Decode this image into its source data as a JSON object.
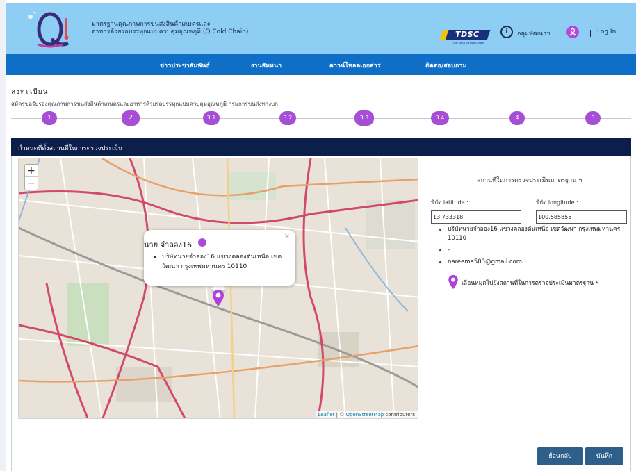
{
  "header": {
    "site_title_line1": "มาตรฐานคุณภาพการขนส่งสินค้าเกษตรและ",
    "site_title_line2": "อาหารด้วยรถบรรทุกแบบควบคุมอุณหภูมิ (Q Cold Chain)",
    "partner_logo_text": "TDSC",
    "partner_logo_sub": "Thai Delta Service Centre",
    "help_label": "กลุ่มพัฒนาฯ",
    "login_label": "Log In"
  },
  "nav": {
    "items": [
      {
        "label": "ข่าวประชาสัมพันธ์"
      },
      {
        "label": "งานสัมมนา"
      },
      {
        "label": "ดาวน์โหลดเอกสาร"
      },
      {
        "label": "ติดต่อ/สอบถาม"
      }
    ]
  },
  "registration": {
    "title": "ลงทะเบียน",
    "subtitle": "สมัครขอรับรองคุณภาพการขนส่งสินค้าเกษตรและอาหารด้วยรถบรรทุกแบบควบคุมอุณหภูมิ กรมการขนส่งทางบก"
  },
  "steps": [
    {
      "label": "1"
    },
    {
      "label": "2"
    },
    {
      "label": "3.1"
    },
    {
      "label": "3.2"
    },
    {
      "label": "3.3"
    },
    {
      "label": "3.4"
    },
    {
      "label": "4"
    },
    {
      "label": "5"
    }
  ],
  "panel": {
    "title": "กำหนดที่ตั้งสถานที่ในการตรวจประเมิน"
  },
  "map": {
    "zoom_in": "+",
    "zoom_out": "−",
    "popup_close": "×",
    "popup_name": "นาย จำลอง16",
    "popup_address": "บริษัทนายจำลอง16 แขวงคลองตันเหนือ เขตวัฒนา กรุงเทพมหานคร 10110",
    "attribution_leaflet": "Leaflet",
    "attribution_sep": " | © ",
    "attribution_osm": "OpenStreetMap",
    "attribution_rest": " contributors"
  },
  "location": {
    "title": "สถานที่ในการตรวจประเมินมาตรฐาน ฯ",
    "lat_label": "พิกัด latitude :",
    "lng_label": "พิกัด longitude :",
    "lat_value": "13.733318",
    "lng_value": "100.585855",
    "info_items": [
      "บริษัทนายจำลอง16 แขวงคลองตันเหนือ เขตวัฒนา กรุงเทพมหานคร 10110",
      "-",
      "nareema503@gmail.com"
    ],
    "drag_hint": "เลื่อนหมุดไปยังสถานที่ในการตรวจประเมินมาตรฐาน ฯ"
  },
  "buttons": {
    "back": "ย้อนกลับ",
    "save": "บันทึก"
  },
  "colors": {
    "header_bg": "#8ecdf4",
    "nav_bg": "#0f6fc6",
    "panel_head_bg": "#0b1f4a",
    "step_purple": "#a64ed6",
    "button_bg": "#2d5f8a"
  }
}
